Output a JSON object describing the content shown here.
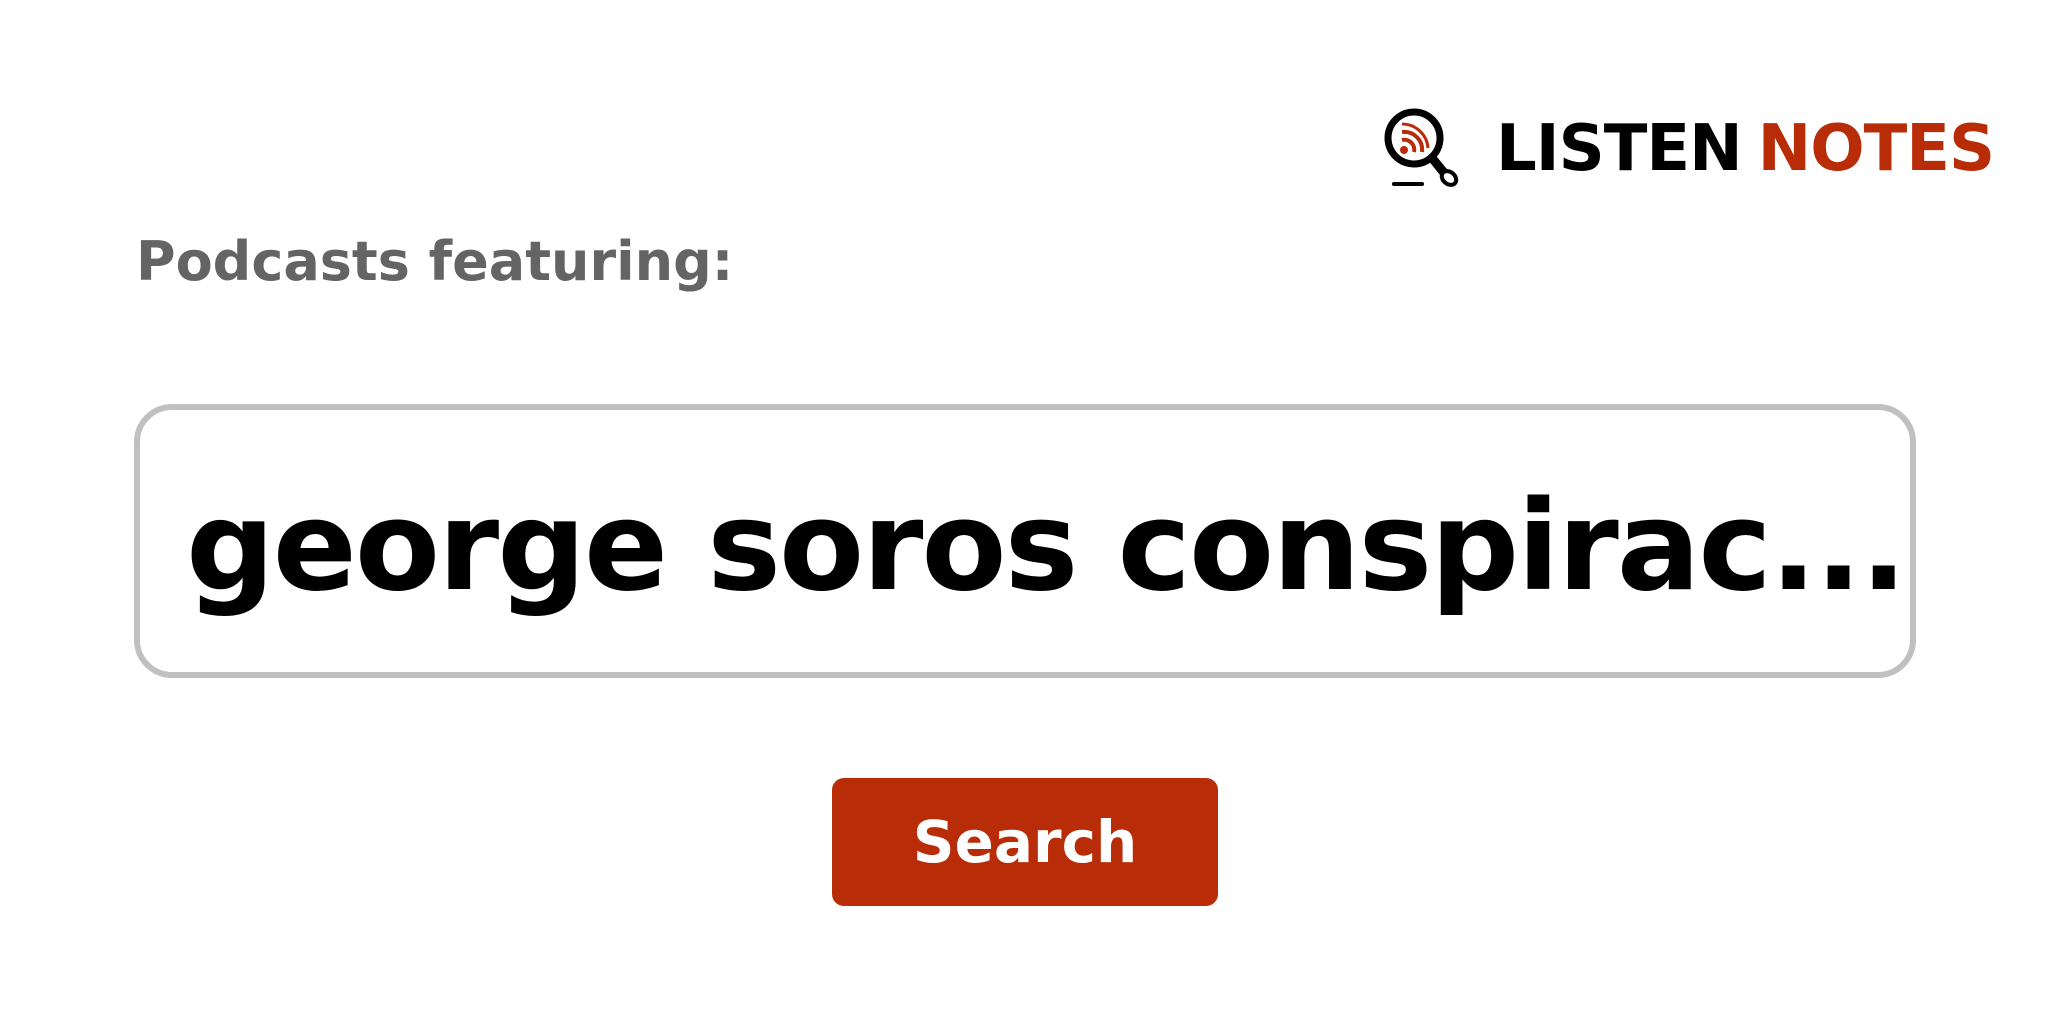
{
  "brand": {
    "word1": "LISTEN",
    "word2": "NOTES",
    "icon": "podcast-search-icon",
    "colors": {
      "dark": "#000000",
      "accent": "#b92c08"
    }
  },
  "heading": "Podcasts featuring:",
  "query": "george soros conspirac...",
  "search_button": {
    "label": "Search",
    "color": "#b92c08"
  },
  "colors": {
    "heading_text": "#646464",
    "box_border": "#c0c0c0",
    "background": "#ffffff"
  }
}
